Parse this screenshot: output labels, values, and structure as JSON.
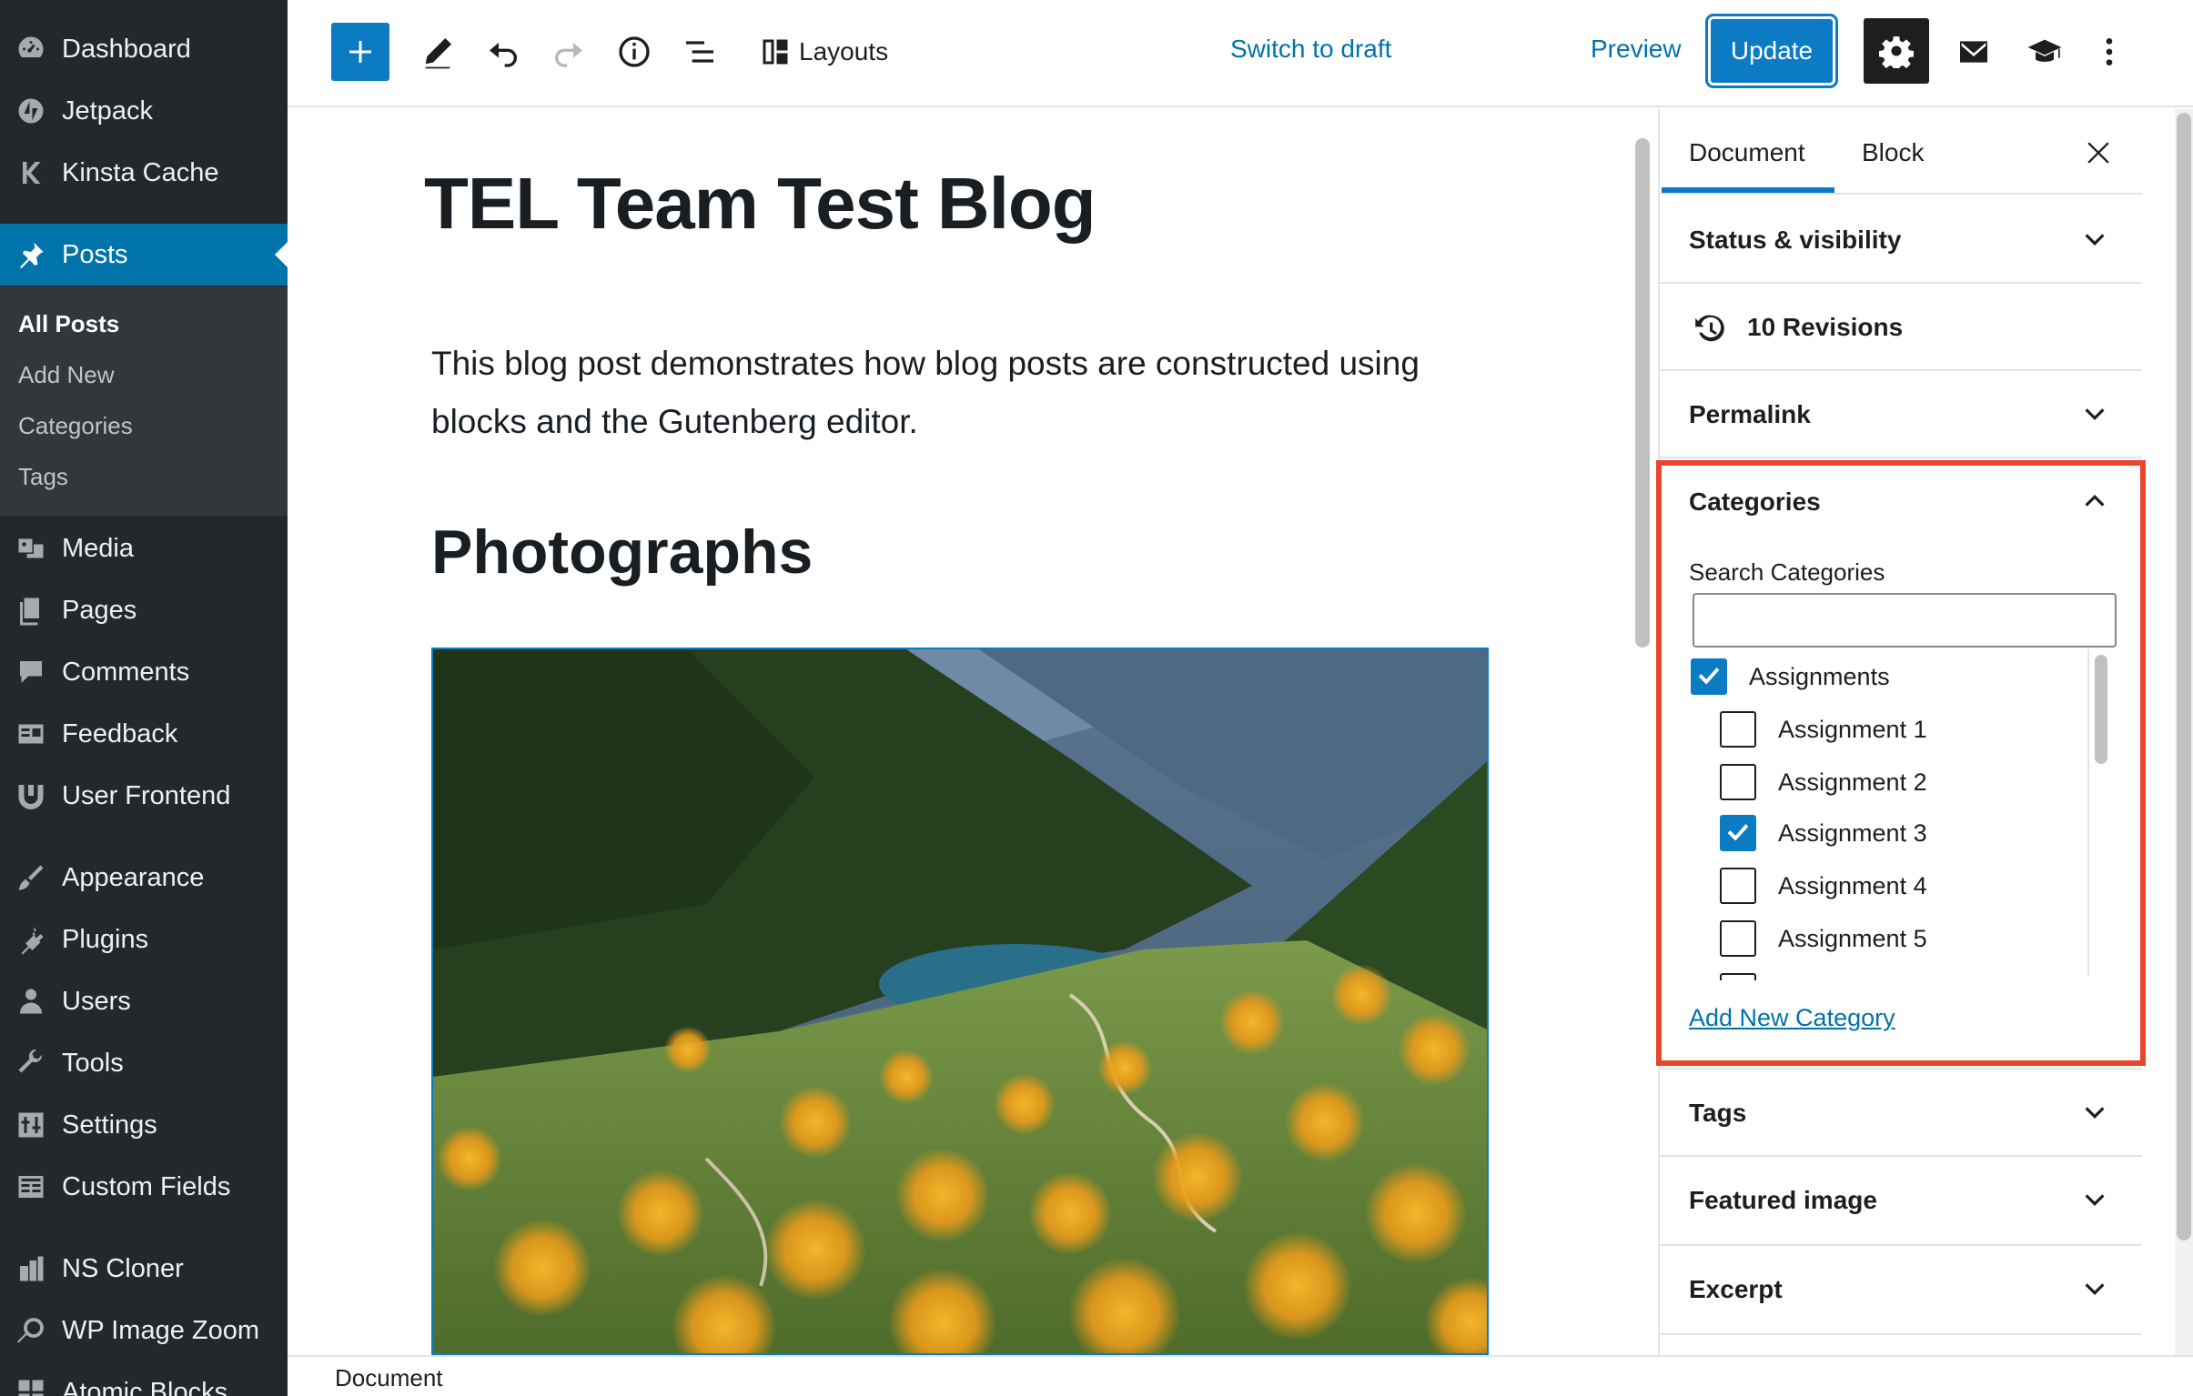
{
  "admin_menu": {
    "top_items": [
      {
        "label": "Dashboard",
        "icon": "dashboard-icon"
      },
      {
        "label": "Jetpack",
        "icon": "jetpack-icon"
      },
      {
        "label": "Kinsta Cache",
        "icon": "kinsta-icon"
      }
    ],
    "active_item": {
      "label": "Posts",
      "icon": "pin-icon"
    },
    "posts_submenu": [
      "All Posts",
      "Add New",
      "Categories",
      "Tags"
    ],
    "lower_items": [
      {
        "label": "Media",
        "icon": "media-icon"
      },
      {
        "label": "Pages",
        "icon": "pages-icon"
      },
      {
        "label": "Comments",
        "icon": "comments-icon"
      },
      {
        "label": "Feedback",
        "icon": "feedback-icon"
      },
      {
        "label": "User Frontend",
        "icon": "user-frontend-icon"
      },
      {
        "label": "Appearance",
        "icon": "appearance-icon"
      },
      {
        "label": "Plugins",
        "icon": "plugins-icon"
      },
      {
        "label": "Users",
        "icon": "users-icon"
      },
      {
        "label": "Tools",
        "icon": "tools-icon"
      },
      {
        "label": "Settings",
        "icon": "settings-icon"
      },
      {
        "label": "Custom Fields",
        "icon": "custom-fields-icon"
      },
      {
        "label": "NS Cloner",
        "icon": "cloner-icon"
      },
      {
        "label": "WP Image Zoom",
        "icon": "zoom-icon"
      },
      {
        "label": "Atomic Blocks",
        "icon": "blocks-icon"
      }
    ]
  },
  "toolbar": {
    "layouts_label": "Layouts",
    "switch_to_draft": "Switch to draft",
    "preview": "Preview",
    "update": "Update"
  },
  "post": {
    "title": "TEL Team Test Blog",
    "paragraph": "This blog post demonstrates how blog posts are constructed using blocks and the Gutenberg editor.",
    "heading": "Photographs"
  },
  "status_bar": {
    "breadcrumb": "Document"
  },
  "settings_sidebar": {
    "tabs": {
      "document": "Document",
      "block": "Block"
    },
    "panels": {
      "status_visibility": "Status & visibility",
      "revisions": "10 Revisions",
      "permalink": "Permalink",
      "categories": "Categories",
      "tags": "Tags",
      "featured_image": "Featured image",
      "excerpt": "Excerpt"
    },
    "categories": {
      "search_label": "Search Categories",
      "search_value": "",
      "items": [
        {
          "label": "Assignments",
          "checked": true,
          "level": 0
        },
        {
          "label": "Assignment 1",
          "checked": false,
          "level": 1
        },
        {
          "label": "Assignment 2",
          "checked": false,
          "level": 1
        },
        {
          "label": "Assignment 3",
          "checked": true,
          "level": 1
        },
        {
          "label": "Assignment 4",
          "checked": false,
          "level": 1
        },
        {
          "label": "Assignment 5",
          "checked": false,
          "level": 1
        }
      ],
      "add_new": "Add New Category"
    }
  },
  "colors": {
    "accent": "#0b7bc3",
    "admin_bg": "#23282d",
    "highlight_border": "#e8452c"
  }
}
